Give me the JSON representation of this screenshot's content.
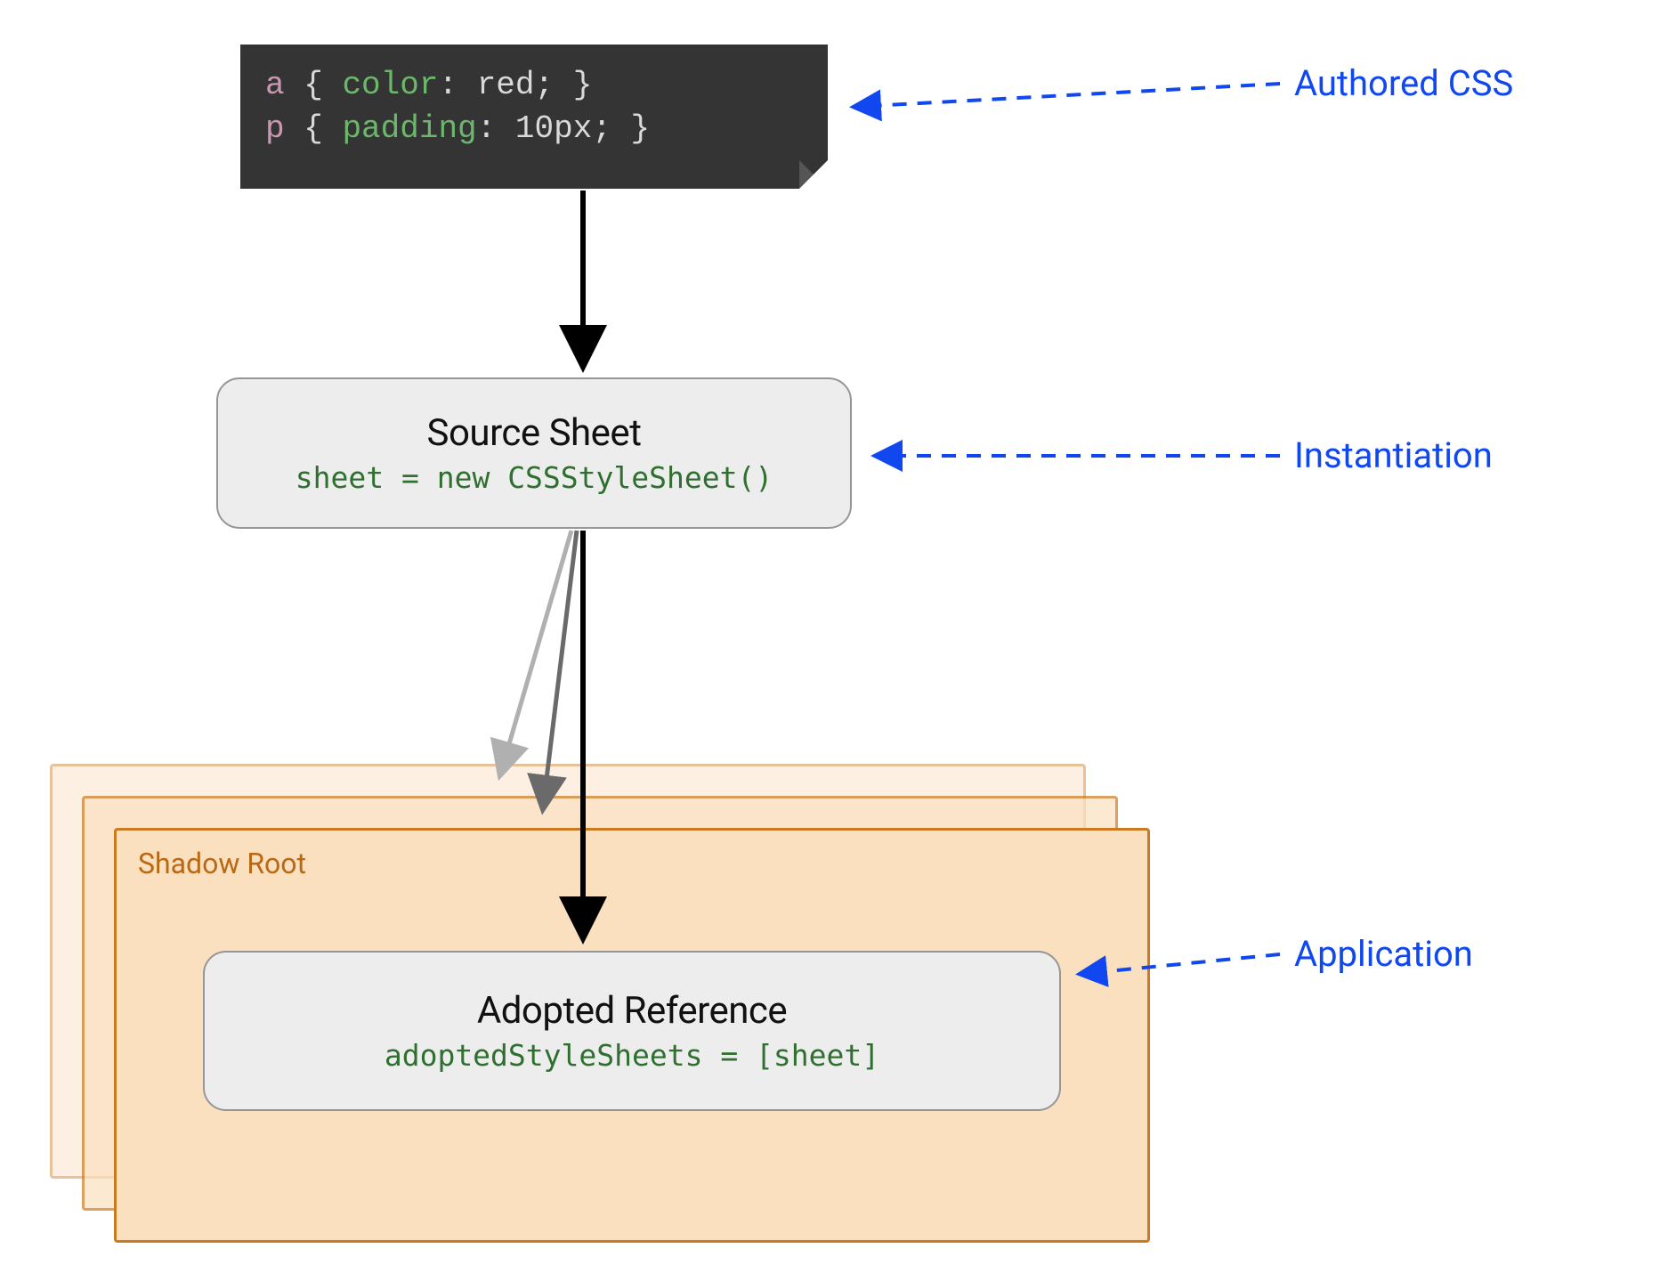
{
  "code": {
    "rule1_selector": "a",
    "rule1_brace_open": "{",
    "rule1_prop": "color",
    "rule1_colon": ":",
    "rule1_value": "red",
    "rule1_semi": ";",
    "rule1_brace_close": "}",
    "rule2_selector": "p",
    "rule2_brace_open": "{",
    "rule2_prop": "padding",
    "rule2_colon": ":",
    "rule2_value": "10px",
    "rule2_semi": ";",
    "rule2_brace_close": "}"
  },
  "source_box": {
    "title": "Source Sheet",
    "code": "sheet = new CSSStyleSheet()"
  },
  "shadow_root_label": "Shadow Root",
  "adopted_box": {
    "title": "Adopted Reference",
    "code": "adoptedStyleSheets = [sheet]"
  },
  "annotations": {
    "authored": "Authored CSS",
    "instantiation": "Instantiation",
    "application": "Application"
  }
}
